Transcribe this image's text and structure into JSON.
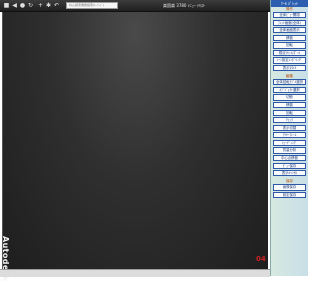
{
  "toolbar": {
    "search_placeholder": "ねん検索機能検索(ｷｰﾜｰﾄﾞ)",
    "title": "楽園楽    3780 ﾒﾆｭｰ ﾃｷｽﾄ"
  },
  "viewport": {
    "brand": "Autodesk",
    "marker": "04"
  },
  "panel": {
    "title": "ﾂｰﾙ ﾊﾟﾚｯﾄ",
    "sections": [
      {
        "label": "操作",
        "buttons": [
          "全体ﾋﾞｭｰ開閉",
          "ﾌｨｯﾄ画面(全体)",
          "全体画面表示",
          "移動",
          "回転",
          "視点ﾘｾｯﾄ/ｽﾞｰﾑ",
          "ｼｰﾝ設定ﾚﾝﾀﾞﾘﾝｸﾞ",
          "表示ｽﾀｲﾙ"
        ]
      },
      {
        "label": "編集",
        "buttons": [
          "全体回転ﾓﾃﾞﾙ選択",
          "ｵﾌﾞｼﾞｪｸﾄ選択",
          "切断",
          "移動",
          "回転",
          "ﾁｪｯｸ",
          "表示切替",
          "ﾜｲﾔｰﾌﾚｰﾑ",
          "ｼｪｰﾃﾞｨﾝｸﾞ",
          "質量分析",
          "中心点移動",
          "ﾋﾞｭｰ保存",
          "表示ｷｬﾝｾﾙ"
        ]
      },
      {
        "label": "保存",
        "buttons": [
          "画像保存",
          "設定保存"
        ]
      }
    ]
  }
}
